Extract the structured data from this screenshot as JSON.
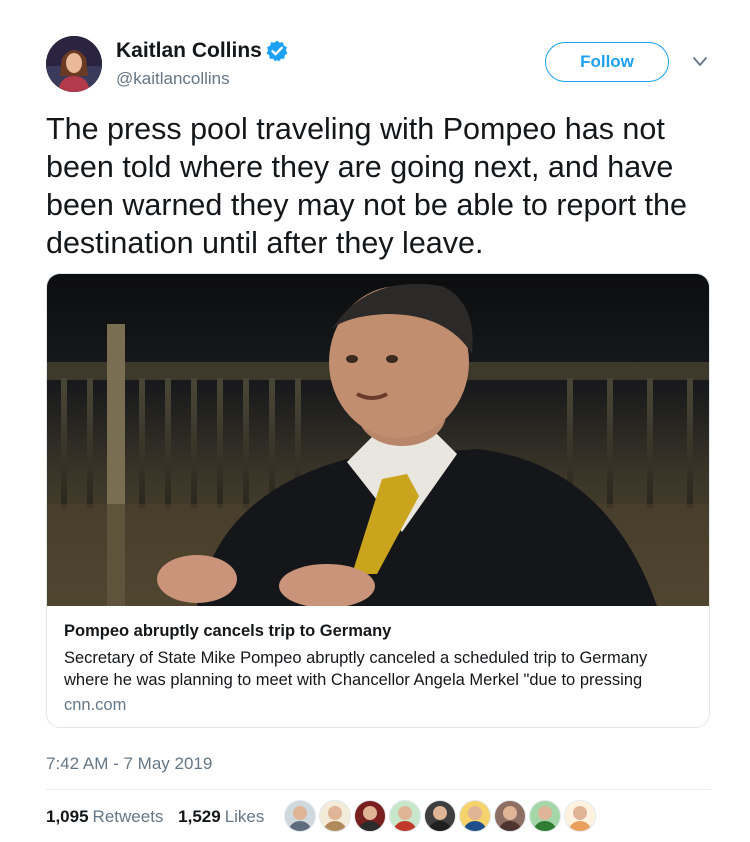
{
  "tweet": {
    "author_name": "Kaitlan Collins",
    "author_handle": "@kaitlancollins",
    "follow_label": "Follow",
    "text": "The press pool traveling with Pompeo has not been told where they are going next, and have been warned they may not be able to report the destination until after they leave.",
    "timestamp": "7:42 AM - 7 May 2019"
  },
  "card": {
    "title": "Pompeo abruptly cancels trip to Germany",
    "description": "Secretary of State Mike Pompeo abruptly canceled a scheduled trip to Germany where he was planning to meet with Chancellor Angela Merkel \"due to pressing",
    "domain": "cnn.com"
  },
  "stats": {
    "retweets_count": "1,095",
    "retweets_label": "Retweets",
    "likes_count": "1,529",
    "likes_label": "Likes"
  },
  "likers": [
    {
      "bg": "#cfd8dc",
      "body": "#5d6d7e"
    },
    {
      "bg": "#f3ead8",
      "body": "#b08a5a"
    },
    {
      "bg": "#7a1f1f",
      "body": "#2b2b2b"
    },
    {
      "bg": "#c8e6c9",
      "body": "#c0392b"
    },
    {
      "bg": "#3e3e3e",
      "body": "#1f1f1f"
    },
    {
      "bg": "#f5d26b",
      "body": "#1f4e8c"
    },
    {
      "bg": "#8d6e63",
      "body": "#4e342e"
    },
    {
      "bg": "#a5d6a7",
      "body": "#2e7d32"
    },
    {
      "bg": "#fff3e0",
      "body": "#e8a05c"
    }
  ],
  "colors": {
    "accent": "#1da1f2",
    "secondary_text": "#657786",
    "primary_text": "#14171a",
    "border": "#e1e8ed"
  },
  "icons": {
    "verified": "verified-badge-icon",
    "caret": "chevron-down-icon"
  }
}
